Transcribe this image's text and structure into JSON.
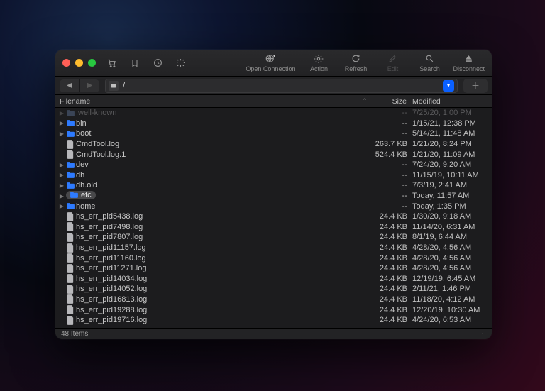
{
  "toolbar": {
    "open_connection": "Open Connection",
    "action": "Action",
    "refresh": "Refresh",
    "edit": "Edit",
    "search": "Search",
    "disconnect": "Disconnect"
  },
  "path": {
    "value": "/"
  },
  "columns": {
    "filename": "Filename",
    "size": "Size",
    "modified": "Modified"
  },
  "status": {
    "items": "48 Items"
  },
  "rows": [
    {
      "kind": "folder",
      "name": ".well-known",
      "size": "--",
      "mod": "7/25/20, 1:00 PM",
      "dim": true,
      "disc": true
    },
    {
      "kind": "folder",
      "name": "bin",
      "size": "--",
      "mod": "1/15/21, 12:38 PM",
      "dim": false,
      "disc": true
    },
    {
      "kind": "folder",
      "name": "boot",
      "size": "--",
      "mod": "5/14/21, 11:48 AM",
      "dim": false,
      "disc": true
    },
    {
      "kind": "file",
      "name": "CmdTool.log",
      "size": "263.7 KB",
      "mod": "1/21/20, 8:24 PM",
      "dim": false,
      "disc": false
    },
    {
      "kind": "file",
      "name": "CmdTool.log.1",
      "size": "524.4 KB",
      "mod": "1/21/20, 11:09 AM",
      "dim": false,
      "disc": false
    },
    {
      "kind": "folder",
      "name": "dev",
      "size": "--",
      "mod": "7/24/20, 9:20 AM",
      "dim": false,
      "disc": true
    },
    {
      "kind": "folder",
      "name": "dh",
      "size": "--",
      "mod": "11/15/19, 10:11 AM",
      "dim": false,
      "disc": true
    },
    {
      "kind": "folder",
      "name": "dh.old",
      "size": "--",
      "mod": "7/3/19, 2:41 AM",
      "dim": false,
      "disc": true
    },
    {
      "kind": "folder",
      "name": "etc",
      "size": "--",
      "mod": "Today, 11:57 AM",
      "dim": false,
      "disc": true,
      "selected": true
    },
    {
      "kind": "folder",
      "name": "home",
      "size": "--",
      "mod": "Today, 1:35 PM",
      "dim": false,
      "disc": true
    },
    {
      "kind": "file",
      "name": "hs_err_pid5438.log",
      "size": "24.4 KB",
      "mod": "1/30/20, 9:18 AM",
      "dim": false,
      "disc": false
    },
    {
      "kind": "file",
      "name": "hs_err_pid7498.log",
      "size": "24.4 KB",
      "mod": "11/14/20, 6:31 AM",
      "dim": false,
      "disc": false
    },
    {
      "kind": "file",
      "name": "hs_err_pid7807.log",
      "size": "24.4 KB",
      "mod": "8/1/19, 6:44 AM",
      "dim": false,
      "disc": false
    },
    {
      "kind": "file",
      "name": "hs_err_pid11157.log",
      "size": "24.4 KB",
      "mod": "4/28/20, 4:56 AM",
      "dim": false,
      "disc": false
    },
    {
      "kind": "file",
      "name": "hs_err_pid11160.log",
      "size": "24.4 KB",
      "mod": "4/28/20, 4:56 AM",
      "dim": false,
      "disc": false
    },
    {
      "kind": "file",
      "name": "hs_err_pid11271.log",
      "size": "24.4 KB",
      "mod": "4/28/20, 4:56 AM",
      "dim": false,
      "disc": false
    },
    {
      "kind": "file",
      "name": "hs_err_pid14034.log",
      "size": "24.4 KB",
      "mod": "12/19/19, 6:45 AM",
      "dim": false,
      "disc": false
    },
    {
      "kind": "file",
      "name": "hs_err_pid14052.log",
      "size": "24.4 KB",
      "mod": "2/11/21, 1:46 PM",
      "dim": false,
      "disc": false
    },
    {
      "kind": "file",
      "name": "hs_err_pid16813.log",
      "size": "24.4 KB",
      "mod": "11/18/20, 4:12 AM",
      "dim": false,
      "disc": false
    },
    {
      "kind": "file",
      "name": "hs_err_pid19288.log",
      "size": "24.4 KB",
      "mod": "12/20/19, 10:30 AM",
      "dim": false,
      "disc": false
    },
    {
      "kind": "file",
      "name": "hs_err_pid19716.log",
      "size": "24.4 KB",
      "mod": "4/24/20, 6:53 AM",
      "dim": false,
      "disc": false
    }
  ]
}
